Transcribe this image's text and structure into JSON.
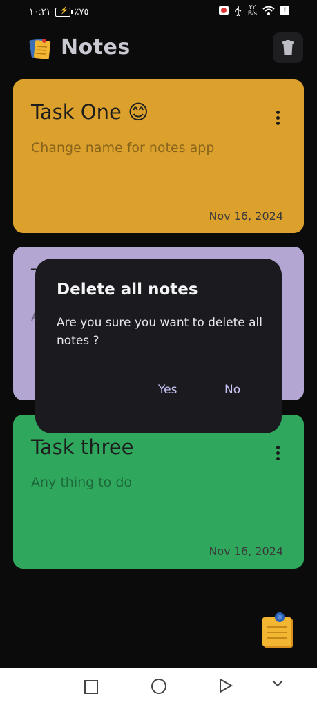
{
  "status_bar": {
    "time": "١٠:٢١",
    "battery_percent": "٪٧٥",
    "speed_value": "٣٢",
    "speed_unit": "B/s"
  },
  "header": {
    "title": "Notes"
  },
  "notes": [
    {
      "title": "Task One 😊",
      "body": "Change name for notes app",
      "date": "Nov 16, 2024",
      "color": "#dca12c"
    },
    {
      "title": "T",
      "body": "A",
      "date": "",
      "color": "#b4a6d3"
    },
    {
      "title": "Task three",
      "body": "Any thing to do",
      "date": "Nov 16, 2024",
      "color": "#2fa85e"
    }
  ],
  "dialog": {
    "title": "Delete all notes",
    "message": "Are you sure you want to delete all notes ?",
    "yes_label": "Yes",
    "no_label": "No"
  },
  "colors": {
    "background": "#0b0b0c",
    "dialog_bg": "#1b1a1e",
    "accent": "#c9c5f7"
  }
}
